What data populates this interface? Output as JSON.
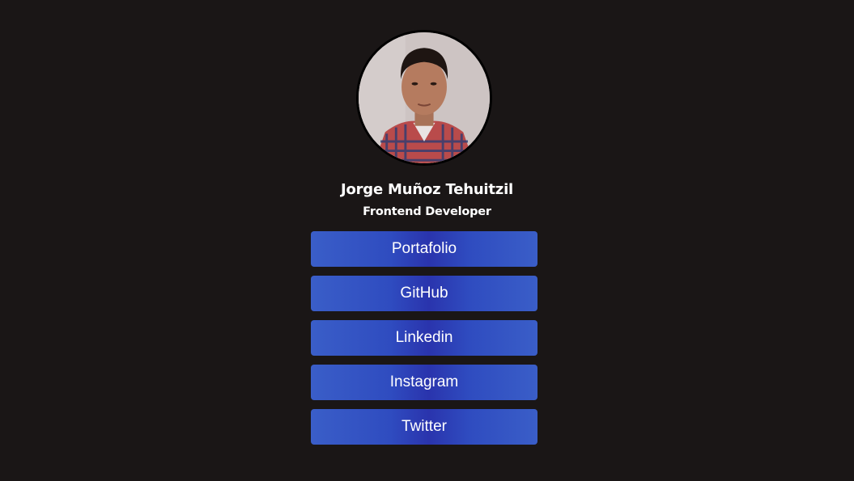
{
  "profile": {
    "name": "Jorge Muñoz Tehuitzil",
    "role": "Frontend Developer",
    "avatar_icon": "profile-photo"
  },
  "links": [
    {
      "label": "Portafolio"
    },
    {
      "label": "GitHub"
    },
    {
      "label": "Linkedin"
    },
    {
      "label": "Instagram"
    },
    {
      "label": "Twitter"
    }
  ],
  "colors": {
    "background": "#1a1616",
    "button_edge": "#3a5ec8",
    "button_center": "#2a34ad",
    "text": "#ffffff"
  }
}
